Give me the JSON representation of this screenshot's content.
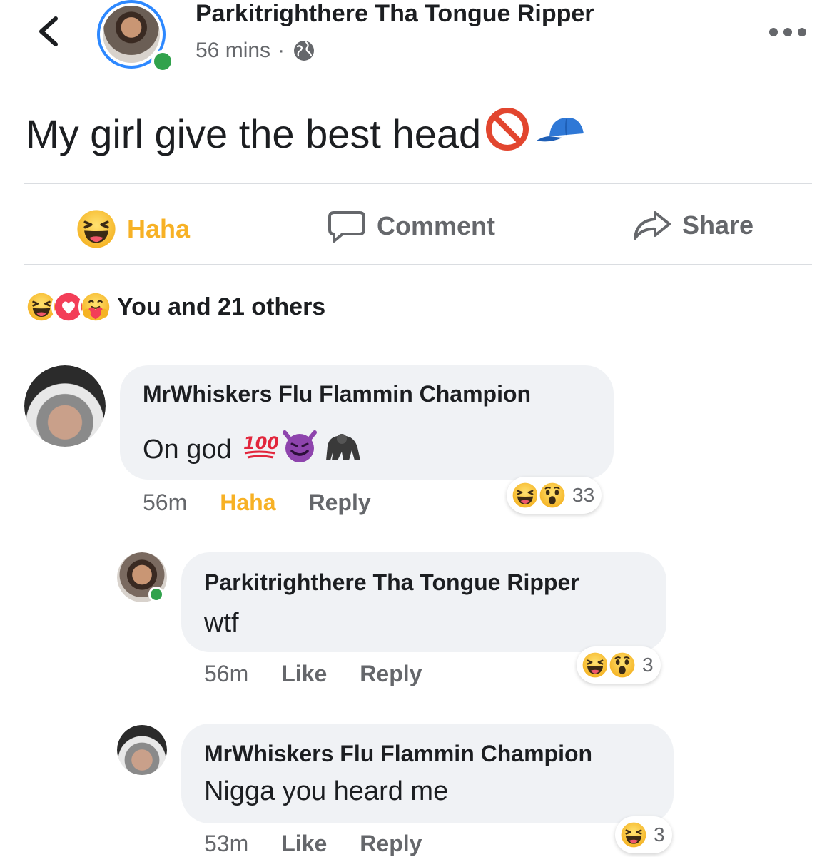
{
  "post": {
    "author": "Parkitrighthere Tha Tongue Ripper",
    "time": "56 mins",
    "separator": "·",
    "privacy_icon": "globe-icon",
    "text": "My girl give the best head"
  },
  "actions": {
    "haha": "Haha",
    "comment": "Comment",
    "share": "Share"
  },
  "reactions_summary": {
    "text": "You and 21 others",
    "icons": [
      "haha-icon",
      "love-icon",
      "care-icon"
    ]
  },
  "comments": [
    {
      "author": "MrWhiskers Flu Flammin Champion",
      "text": "On god",
      "emojis": [
        "hundred-points-icon",
        "smiling-devil-icon",
        "gorilla-icon"
      ],
      "time": "56m",
      "reaction_label": "Haha",
      "reply_label": "Reply",
      "reaction_count": "33"
    },
    {
      "author": "Parkitrighthere Tha Tongue Ripper",
      "text": "wtf",
      "time": "56m",
      "like_label": "Like",
      "reply_label": "Reply",
      "reaction_count": "3"
    },
    {
      "author": "MrWhiskers Flu Flammin Champion",
      "text": "Nigga you heard me",
      "time": "53m",
      "like_label": "Like",
      "reply_label": "Reply",
      "reaction_count": "3"
    }
  ],
  "colors": {
    "haha_yellow": "#f7b125",
    "online_green": "#31a24c",
    "story_ring_blue": "#2d88ff",
    "secondary_text": "#65676b",
    "bubble_bg": "#f0f2f5"
  }
}
